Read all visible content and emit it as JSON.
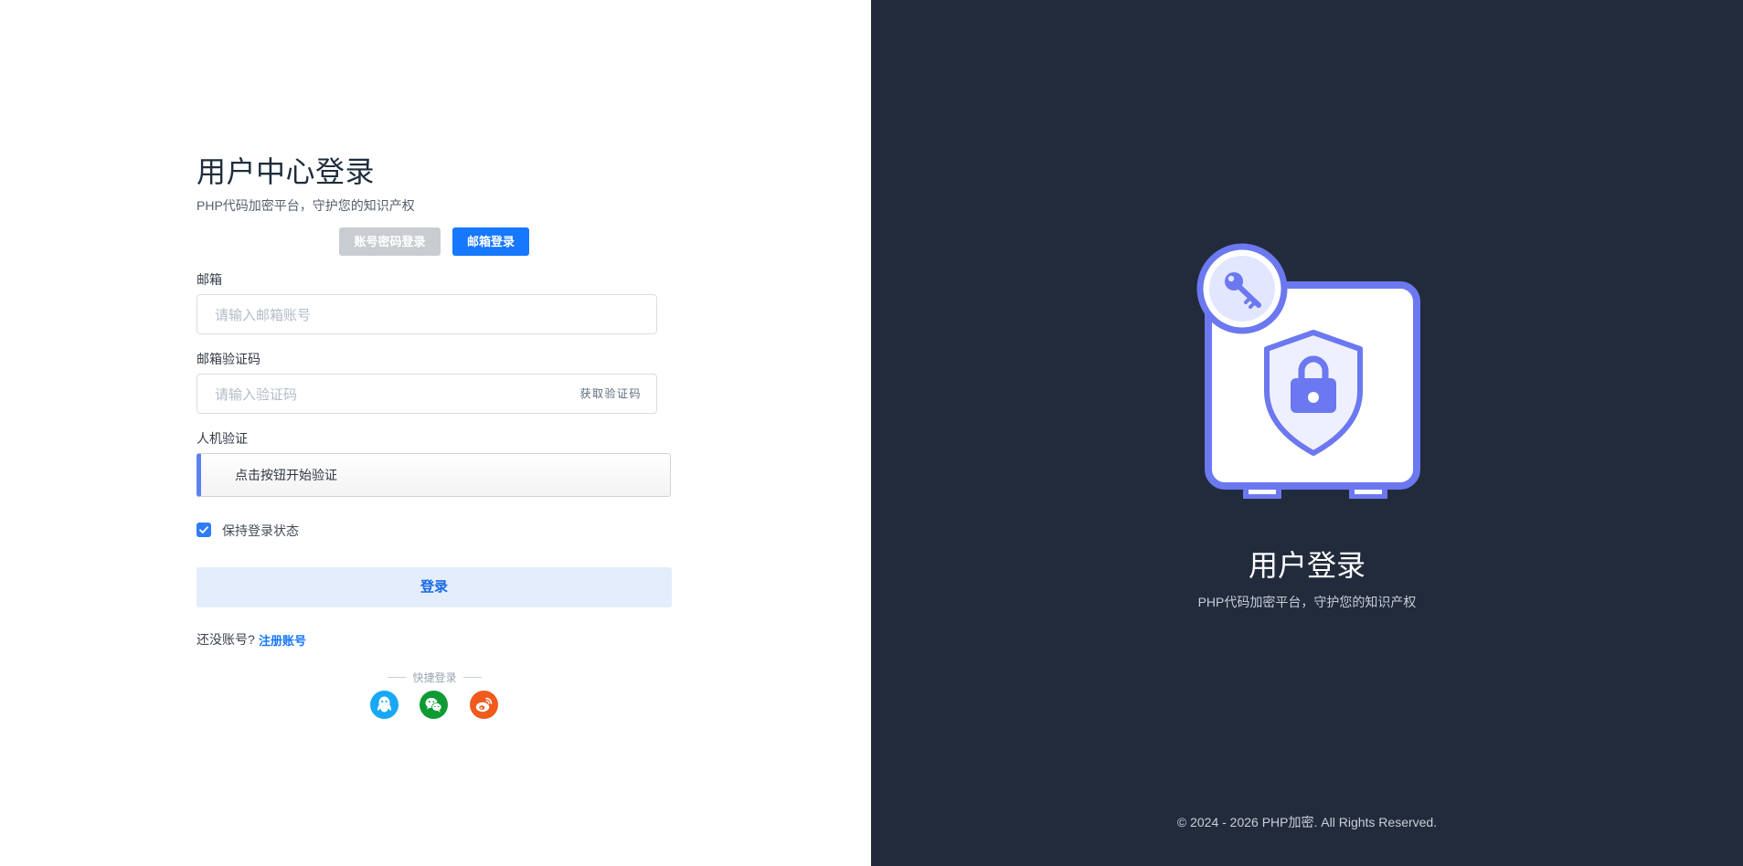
{
  "login": {
    "title": "用户中心登录",
    "subtitle": "PHP代码加密平台，守护您的知识产权",
    "tabs": {
      "password_label": "账号密码登录",
      "email_label": "邮箱登录",
      "active": "email"
    },
    "email_field": {
      "label": "邮箱",
      "placeholder": "请输入邮箱账号",
      "value": ""
    },
    "code_field": {
      "label": "邮箱验证码",
      "placeholder": "请输入验证码",
      "value": "",
      "get_code_label": "获取验证码"
    },
    "captcha": {
      "label": "人机验证",
      "prompt": "点击按钮开始验证"
    },
    "remember": {
      "label": "保持登录状态",
      "checked": true
    },
    "submit_label": "登录",
    "register": {
      "prompt": "还没账号?",
      "link_label": "注册账号"
    },
    "quick_login": {
      "title": "快捷登录",
      "providers": [
        {
          "name": "QQ",
          "icon": "qq-icon",
          "color": "#18a8f5"
        },
        {
          "name": "微信",
          "icon": "wechat-icon",
          "color": "#0f9a33"
        },
        {
          "name": "微博",
          "icon": "weibo-icon",
          "color": "#f15a1d"
        }
      ]
    }
  },
  "hero": {
    "title": "用户登录",
    "subtitle": "PHP代码加密平台，守护您的知识产权",
    "illustration_icon": "safe-with-shield-lock-and-key-icon"
  },
  "footer": {
    "copyright": "© 2024 - 2026 PHP加密. All Rights Reserved."
  },
  "colors": {
    "accent": "#1677ff",
    "right_panel_bg": "#212b3b",
    "illustration": "#6b78f0"
  }
}
